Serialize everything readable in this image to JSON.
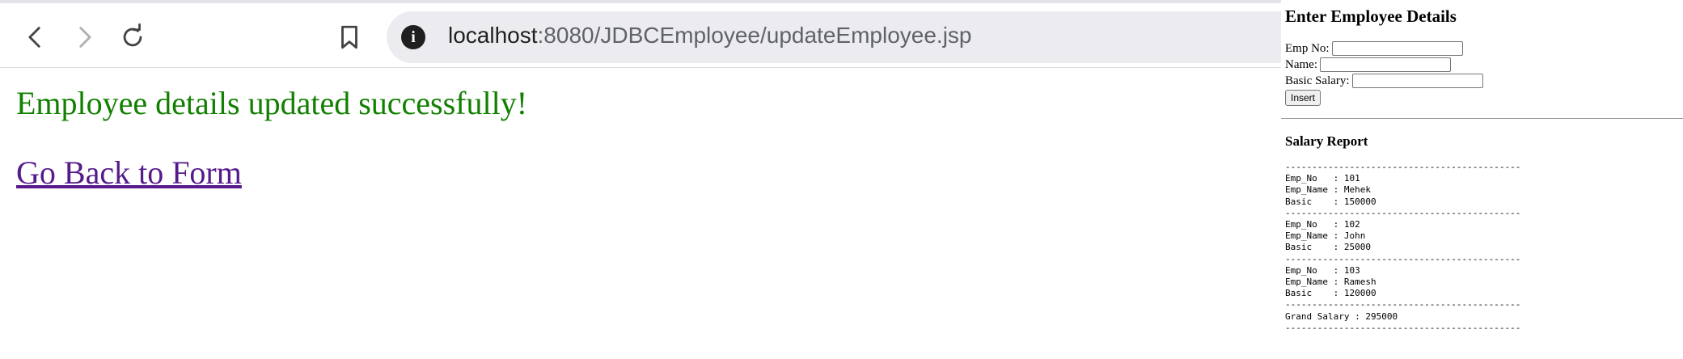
{
  "browser": {
    "url_host": "localhost",
    "url_path": ":8080/JDBCEmployee/updateEmployee.jsp"
  },
  "page": {
    "success_message": "Employee details updated successfully!",
    "back_link": "Go Back to Form"
  },
  "panel": {
    "title": "Enter Employee Details",
    "form": {
      "empno_label": "Emp No:",
      "name_label": "Name:",
      "salary_label": "Basic Salary:",
      "insert_label": "Insert"
    },
    "report_title": "Salary Report",
    "separator": "--------------------------------------------",
    "records": [
      {
        "no_line": "Emp_No   : 101",
        "name_line": "Emp_Name : Mehek",
        "basic_line": "Basic    : 150000"
      },
      {
        "no_line": "Emp_No   : 102",
        "name_line": "Emp_Name : John",
        "basic_line": "Basic    : 25000"
      },
      {
        "no_line": "Emp_No   : 103",
        "name_line": "Emp_Name : Ramesh",
        "basic_line": "Basic    : 120000"
      }
    ],
    "grand_total": "Grand Salary : 295000"
  }
}
